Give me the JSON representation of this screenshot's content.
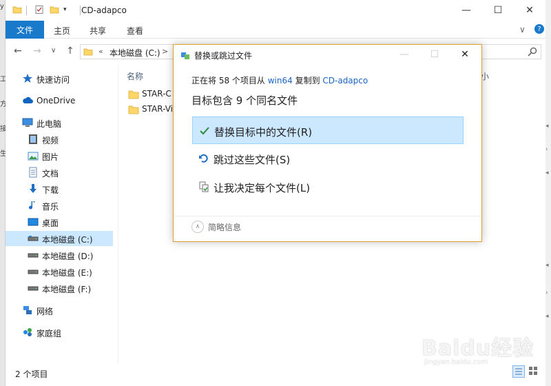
{
  "window": {
    "title": "CD-adapco",
    "minimize": "—",
    "maximize": "☐",
    "close": "✕"
  },
  "ribbon": {
    "tabs": [
      "文件",
      "主页",
      "共享",
      "查看"
    ],
    "expand": "∨",
    "help": "?"
  },
  "nav": {
    "back": "←",
    "forward": "→",
    "recent": "∨",
    "up": "↑",
    "breadcrumb_chevron": "«",
    "path": "本地磁盘 (C:)",
    "path_sep": ">"
  },
  "sidebar": {
    "items": [
      {
        "label": "快速访问",
        "icon": "star-icon"
      },
      {
        "label": "OneDrive",
        "icon": "cloud-icon"
      },
      {
        "label": "此电脑",
        "icon": "computer-icon"
      },
      {
        "label": "视频",
        "icon": "video-icon"
      },
      {
        "label": "图片",
        "icon": "picture-icon"
      },
      {
        "label": "文档",
        "icon": "document-icon"
      },
      {
        "label": "下载",
        "icon": "download-icon"
      },
      {
        "label": "音乐",
        "icon": "music-icon"
      },
      {
        "label": "桌面",
        "icon": "desktop-icon"
      },
      {
        "label": "本地磁盘 (C:)",
        "icon": "drive-icon"
      },
      {
        "label": "本地磁盘 (D:)",
        "icon": "drive-icon"
      },
      {
        "label": "本地磁盘 (E:)",
        "icon": "drive-icon"
      },
      {
        "label": "本地磁盘 (F:)",
        "icon": "drive-icon"
      },
      {
        "label": "网络",
        "icon": "network-icon"
      },
      {
        "label": "家庭组",
        "icon": "homegroup-icon"
      }
    ]
  },
  "files": {
    "header_name": "名称",
    "header_size": "小",
    "rows": [
      {
        "name": "STAR-C"
      },
      {
        "name": "STAR-Vi"
      }
    ]
  },
  "status": {
    "count": "2 个项目"
  },
  "left_clip": [
    "y",
    "工",
    "方",
    "接",
    "生"
  ],
  "dialog": {
    "title": "替换或跳过文件",
    "min": "—",
    "max": "☐",
    "close": "✕",
    "progress_prefix": "正在将 58 个项目从 ",
    "source": "win64",
    "progress_mid": " 复制到 ",
    "dest": "CD-adapco",
    "heading": "目标包含 9 个同名文件",
    "options": [
      {
        "label": "替换目标中的文件(R)",
        "icon": "checkmark-icon",
        "selected": true
      },
      {
        "label": "跳过这些文件(S)",
        "icon": "skip-arrow-icon",
        "selected": false
      },
      {
        "label": "让我决定每个文件(L)",
        "icon": "compare-files-icon",
        "selected": false
      }
    ],
    "details_toggle": "∧",
    "details_label": "简略信息"
  },
  "watermark": {
    "logo": "Baidu经验",
    "url": "jingyan.baidu.com"
  },
  "colors": {
    "accent": "#1979ca",
    "selection": "#cce8ff",
    "link": "#1a64c4",
    "dialog_border": "#e39d2f"
  }
}
